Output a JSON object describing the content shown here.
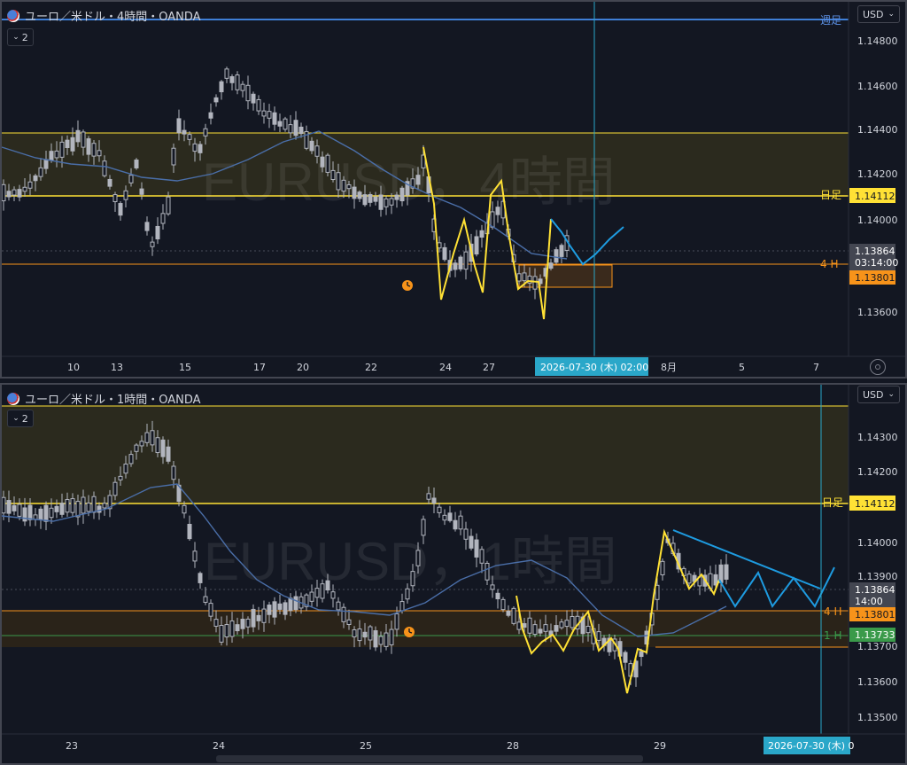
{
  "colors": {
    "background": "#131722",
    "candle": "#b2b5be",
    "ma": "#4a6ea8",
    "yellow_line": "#ffe135",
    "zone_fill": "#2b2a1e",
    "orange_line": "#f7931a",
    "orange_zone": "#3a2a1c",
    "blue_path": "#1e9be0",
    "green_line": "#3a9a4a",
    "crosshair": "#2aa7c9",
    "header_line": "#3f7fd6"
  },
  "top": {
    "title": "ユーロ／米ドル・4時間・OANDA",
    "collapse_label": "2",
    "currency": "USD",
    "watermark": "EURUSD，4時間",
    "price_labels": [
      "1.14800",
      "1.14600",
      "1.14400",
      "1.14200",
      "1.14000",
      "1.13600"
    ],
    "line_labels": {
      "weekly": "週足",
      "daily": "日足",
      "h4": "4 H"
    },
    "badges": {
      "daily": "1.14112",
      "current": "1.13864",
      "countdown": "03:14:00",
      "h4": "1.13801"
    },
    "x_labels": [
      "10",
      "13",
      "15",
      "17",
      "20",
      "22",
      "24",
      "27",
      "8月",
      "5",
      "7"
    ],
    "crosshair_date": "2026-07-30 (木)   02:00"
  },
  "bottom": {
    "title": "ユーロ／米ドル・1時間・OANDA",
    "collapse_label": "2",
    "currency": "USD",
    "watermark": "EURUSD，1時間",
    "price_labels": [
      "1.14300",
      "1.14200",
      "1.14000",
      "1.13900",
      "1.13700",
      "1.13600",
      "1.13500"
    ],
    "line_labels": {
      "daily": "日足",
      "h4": "4 H",
      "h1": "1 H"
    },
    "badges": {
      "daily": "1.14112",
      "current": "1.13864",
      "countdown": "14:00",
      "h4": "1.13801",
      "h1": "1.13733"
    },
    "x_labels": [
      "23",
      "24",
      "25",
      "28",
      "29"
    ],
    "crosshair_date": "2026-07-30 (木)   0"
  }
}
